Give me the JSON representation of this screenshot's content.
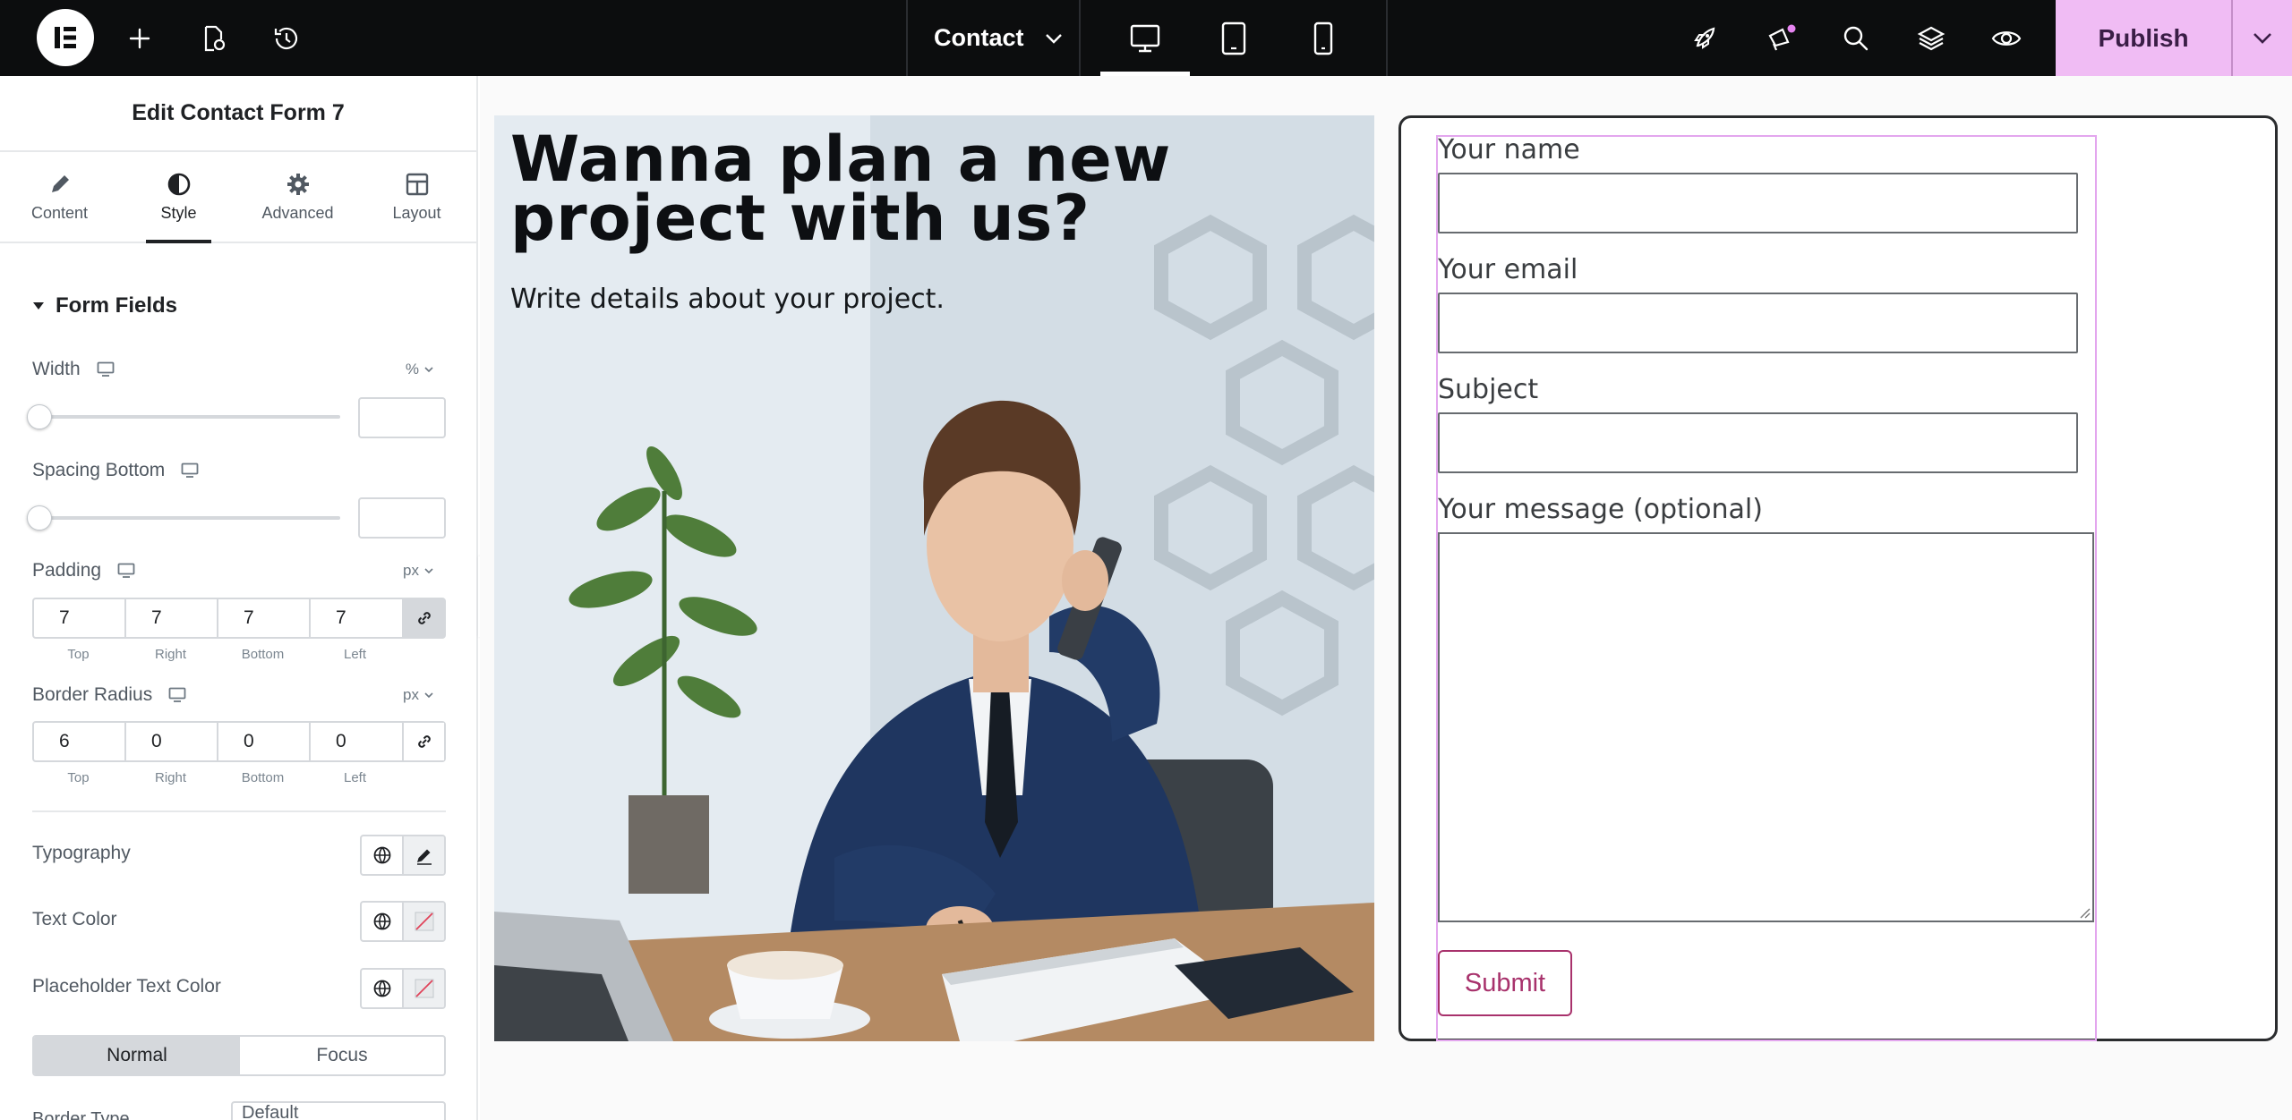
{
  "topbar": {
    "page_name": "Contact",
    "publish_label": "Publish",
    "icons": [
      "elementor-logo-icon",
      "add-element-icon",
      "page-settings-icon",
      "history-icon",
      "chevron-down-icon",
      "desktop-icon",
      "tablet-icon",
      "mobile-icon",
      "rocket-icon",
      "megaphone-icon",
      "search-icon",
      "layers-icon",
      "preview-eye-icon"
    ],
    "active_device": "desktop",
    "accent_color": "#f0bcf4"
  },
  "panel": {
    "title": "Edit Contact Form 7",
    "tabs": [
      {
        "label": "Content",
        "icon": "pencil-icon"
      },
      {
        "label": "Style",
        "icon": "half-circle-icon"
      },
      {
        "label": "Advanced",
        "icon": "gear-icon"
      },
      {
        "label": "Layout",
        "icon": "layout-icon"
      }
    ],
    "active_tab": "Style",
    "section_title": "Form Fields",
    "width": {
      "label": "Width",
      "unit": "%",
      "value": ""
    },
    "spacing_bottom": {
      "label": "Spacing Bottom",
      "value": ""
    },
    "padding": {
      "label": "Padding",
      "unit": "px",
      "values": [
        "7",
        "7",
        "7",
        "7"
      ],
      "linked": true
    },
    "border_radius": {
      "label": "Border Radius",
      "unit": "px",
      "values": [
        "6",
        "0",
        "0",
        "0"
      ],
      "linked": false
    },
    "dim_labels": [
      "Top",
      "Right",
      "Bottom",
      "Left"
    ],
    "typography_label": "Typography",
    "text_color_label": "Text Color",
    "placeholder_color_label": "Placeholder Text Color",
    "state_tabs": [
      "Normal",
      "Focus"
    ],
    "active_state": "Normal",
    "border_type_label": "Border Type",
    "border_type_value": "Default"
  },
  "canvas": {
    "hero": {
      "heading": "Wanna plan a new project with us?",
      "subheading": "Write details about your project."
    },
    "form": {
      "fields": [
        {
          "label": "Your name"
        },
        {
          "label": "Your email"
        },
        {
          "label": "Subject"
        }
      ],
      "message_label": "Your message (optional)",
      "submit_label": "Submit",
      "submit_color": "#a8326c"
    }
  }
}
